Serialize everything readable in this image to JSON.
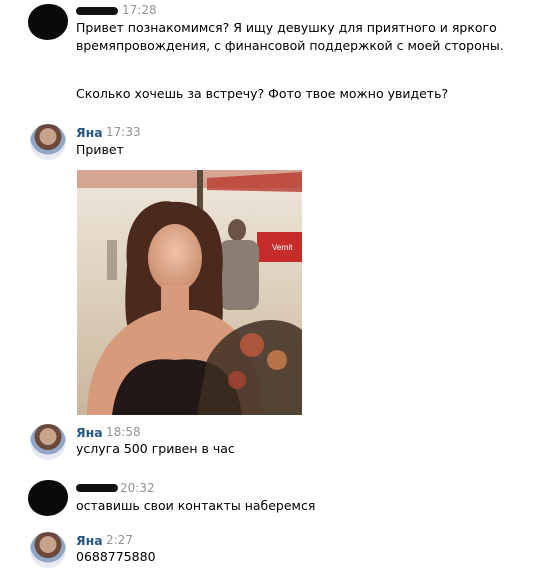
{
  "messages": [
    {
      "sender": "",
      "time": "17:28",
      "paragraph1": "Привет познакомимся? Я ищу девушку для приятного и яркого времяпровождения, с финансовой поддержкой с моей стороны.",
      "paragraph2": "Сколько хочешь за встречу? Фото твое можно увидеть?"
    },
    {
      "sender": "Яна",
      "time": "17:33",
      "text": "Привет"
    },
    {
      "sender": "Яна",
      "time": "18:58",
      "text": "услуга 500 гривен в час"
    },
    {
      "sender": "",
      "time": "20:32",
      "text": "оставишь свои контакты наберемся"
    },
    {
      "sender": "Яна",
      "time": "2:27",
      "text": "0688775880"
    }
  ],
  "photo": {
    "sign_text": "Vernit"
  }
}
